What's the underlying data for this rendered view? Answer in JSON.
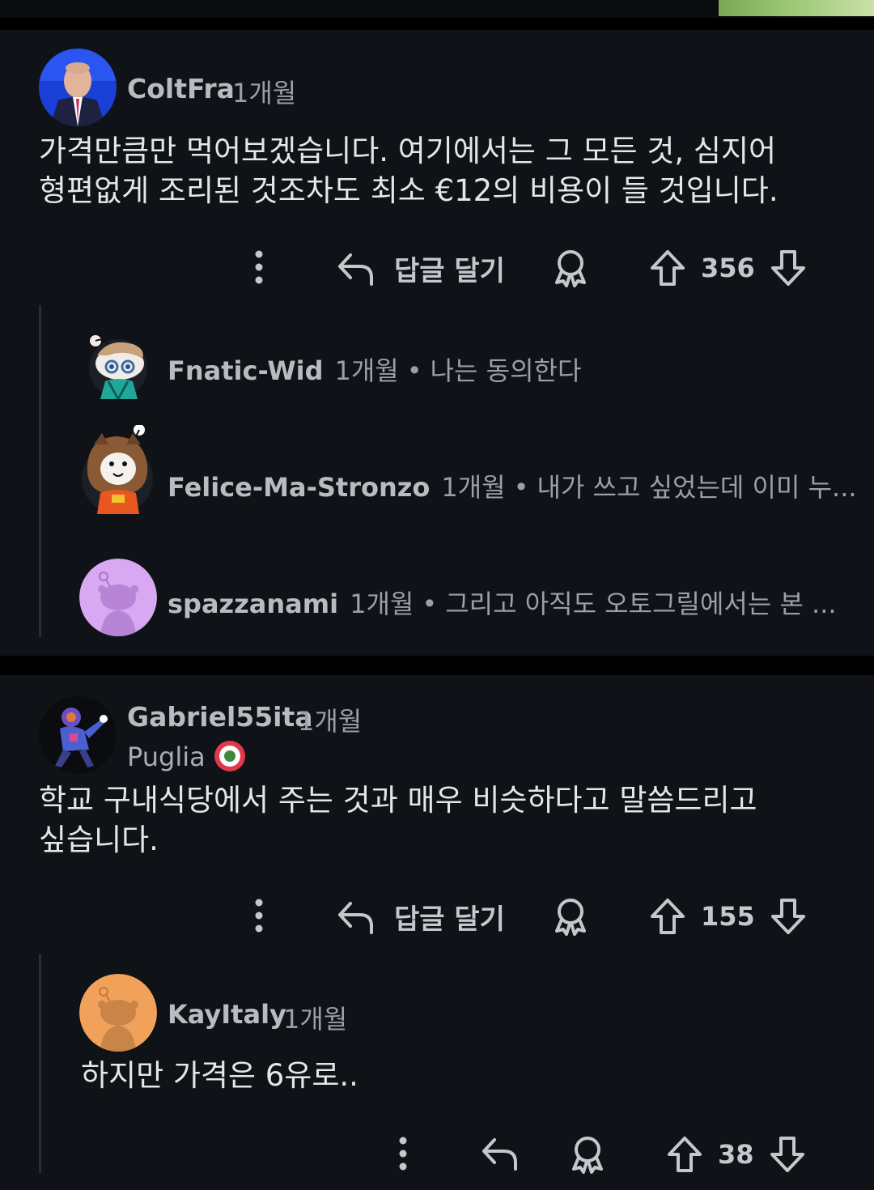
{
  "comments": [
    {
      "username": "ColtFra",
      "time": "1개월",
      "text_line1": "가격만큼만 먹어보겠습니다. 여기에서는 그 모든 것, 심지어",
      "text_line2": "형편없게 조리된 것조차도 최소 €12의 비용이 들 것입니다.",
      "reply_label": "답글 달기",
      "votes": "356",
      "replies": [
        {
          "username": "Fnatic-Wid",
          "time": "1개월",
          "dot": "•",
          "snippet": "나는 동의한다"
        },
        {
          "username": "Felice-Ma-Stronzo",
          "time": "1개월",
          "dot": "•",
          "snippet": "내가 쓰고 싶었는데 이미 누..."
        },
        {
          "username": "spazzanami",
          "time": "1개월",
          "dot": "•",
          "snippet": "그리고 아직도 오토그릴에서는 본 ..."
        }
      ]
    },
    {
      "username": "Gabriel55ita",
      "time": "1개월",
      "flair": "Puglia",
      "text_line1": "학교 구내식당에서 주는 것과 매우 비슷하다고 말씀드리고",
      "text_line2": "싶습니다.",
      "reply_label": "답글 달기",
      "votes": "155",
      "reply": {
        "username": "KayItaly",
        "time": "1개월",
        "text": "하지만 가격은 6유로..",
        "votes": "38"
      }
    }
  ],
  "icons": {
    "more": "more-vertical-icon",
    "reply": "reply-arrow-icon",
    "award": "award-icon",
    "upvote": "upvote-arrow-icon",
    "downvote": "downvote-arrow-icon"
  },
  "colors": {
    "card_bg": "#0f1216",
    "page_bg": "#000000",
    "text": "#e4e6e8",
    "muted": "#9aa0a6",
    "flair_badge": "#e0394b"
  }
}
